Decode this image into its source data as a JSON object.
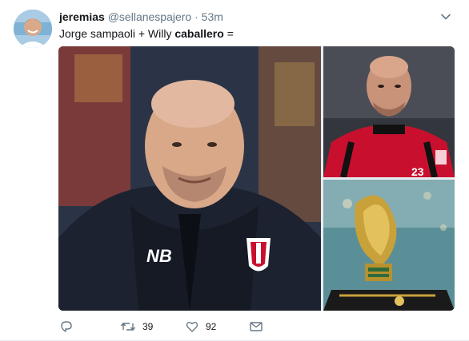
{
  "tweet": {
    "display_name": "jeremias",
    "handle": "@sellanespajero",
    "separator": "·",
    "time": "53m",
    "text_prefix": "Jorge sampaoli + Willy ",
    "text_bold": "caballero",
    "text_suffix": " ="
  },
  "actions": {
    "retweets": "39",
    "likes": "92"
  },
  "colors": {
    "text": "#14171a",
    "muted": "#657786",
    "border": "#e6ecf0"
  },
  "icons": {
    "reply": "reply-icon",
    "retweet": "retweet-icon",
    "like": "heart-icon",
    "message": "envelope-icon",
    "caret": "chevron-down-icon"
  }
}
